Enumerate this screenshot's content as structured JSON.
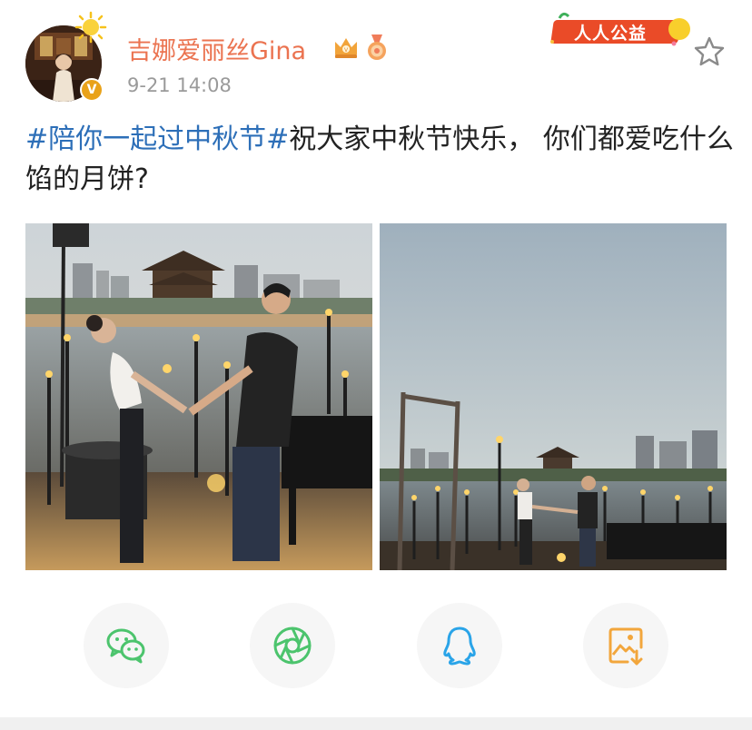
{
  "header": {
    "username": "吉娜爱丽丝Gina",
    "timestamp": "9-21 14:08",
    "public_badge": "人人公益",
    "avatar_verified": "V"
  },
  "post": {
    "hashtag": "#陪你一起过中秋节#",
    "body": "祝大家中秋节快乐， 你们都爱吃什么馅的月饼?"
  },
  "icons": {
    "crown": "crown-icon",
    "medal": "medal-icon",
    "star": "star-icon",
    "wechat": "wechat-icon",
    "moments": "moments-icon",
    "qq": "qq-icon",
    "save": "save-image-icon"
  },
  "colors": {
    "username": "#eb7350",
    "hashtag": "#2d6fb8",
    "wechat": "#4cc46d",
    "moments": "#4cc46d",
    "qq": "#2aa4e8",
    "save": "#f2a63c"
  }
}
